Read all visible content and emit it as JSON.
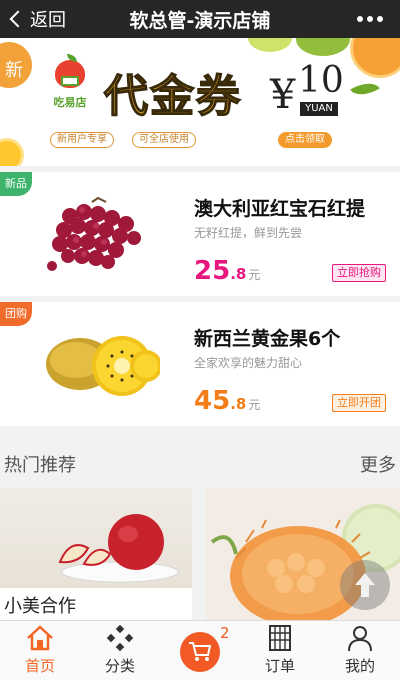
{
  "header": {
    "back_label": "返回",
    "title": "软总管-演示店铺"
  },
  "banner": {
    "corner_badge": "新",
    "logo_text": "吃易店",
    "coupon_title": "代金券",
    "currency": "¥",
    "amount": "10",
    "unit_en": "YUAN",
    "tags": [
      "新用户专享",
      "可全店使用"
    ],
    "claim_label": "点击领取"
  },
  "products": [
    {
      "corner": "新品",
      "name": "澳大利亚红宝石红提",
      "desc": "无籽红提，鲜到先尝",
      "price_int": "25",
      "price_dec": ".8",
      "price_unit": "元",
      "action": "立即抢购"
    },
    {
      "corner": "团购",
      "name": "新西兰黄金果6个",
      "desc": "全家欢享的魅力甜心",
      "price_int": "45",
      "price_dec": ".8",
      "price_unit": "元",
      "action": "立即开团"
    }
  ],
  "hot": {
    "title": "热门推荐",
    "more": "更多",
    "items": [
      {
        "label": "小美合作"
      }
    ]
  },
  "tabbar": {
    "items": [
      {
        "label": "首页",
        "icon": "home-icon",
        "active": true
      },
      {
        "label": "分类",
        "icon": "category-icon",
        "active": false
      },
      {
        "label": "",
        "icon": "cart-icon",
        "active": false
      },
      {
        "label": "订单",
        "icon": "order-icon",
        "active": false
      },
      {
        "label": "我的",
        "icon": "profile-icon",
        "active": false
      }
    ],
    "cart_count": "2"
  },
  "colors": {
    "accent": "#f26522",
    "price_pink": "#e8177e",
    "price_orange": "#f27d19",
    "header_bg": "#262626"
  }
}
